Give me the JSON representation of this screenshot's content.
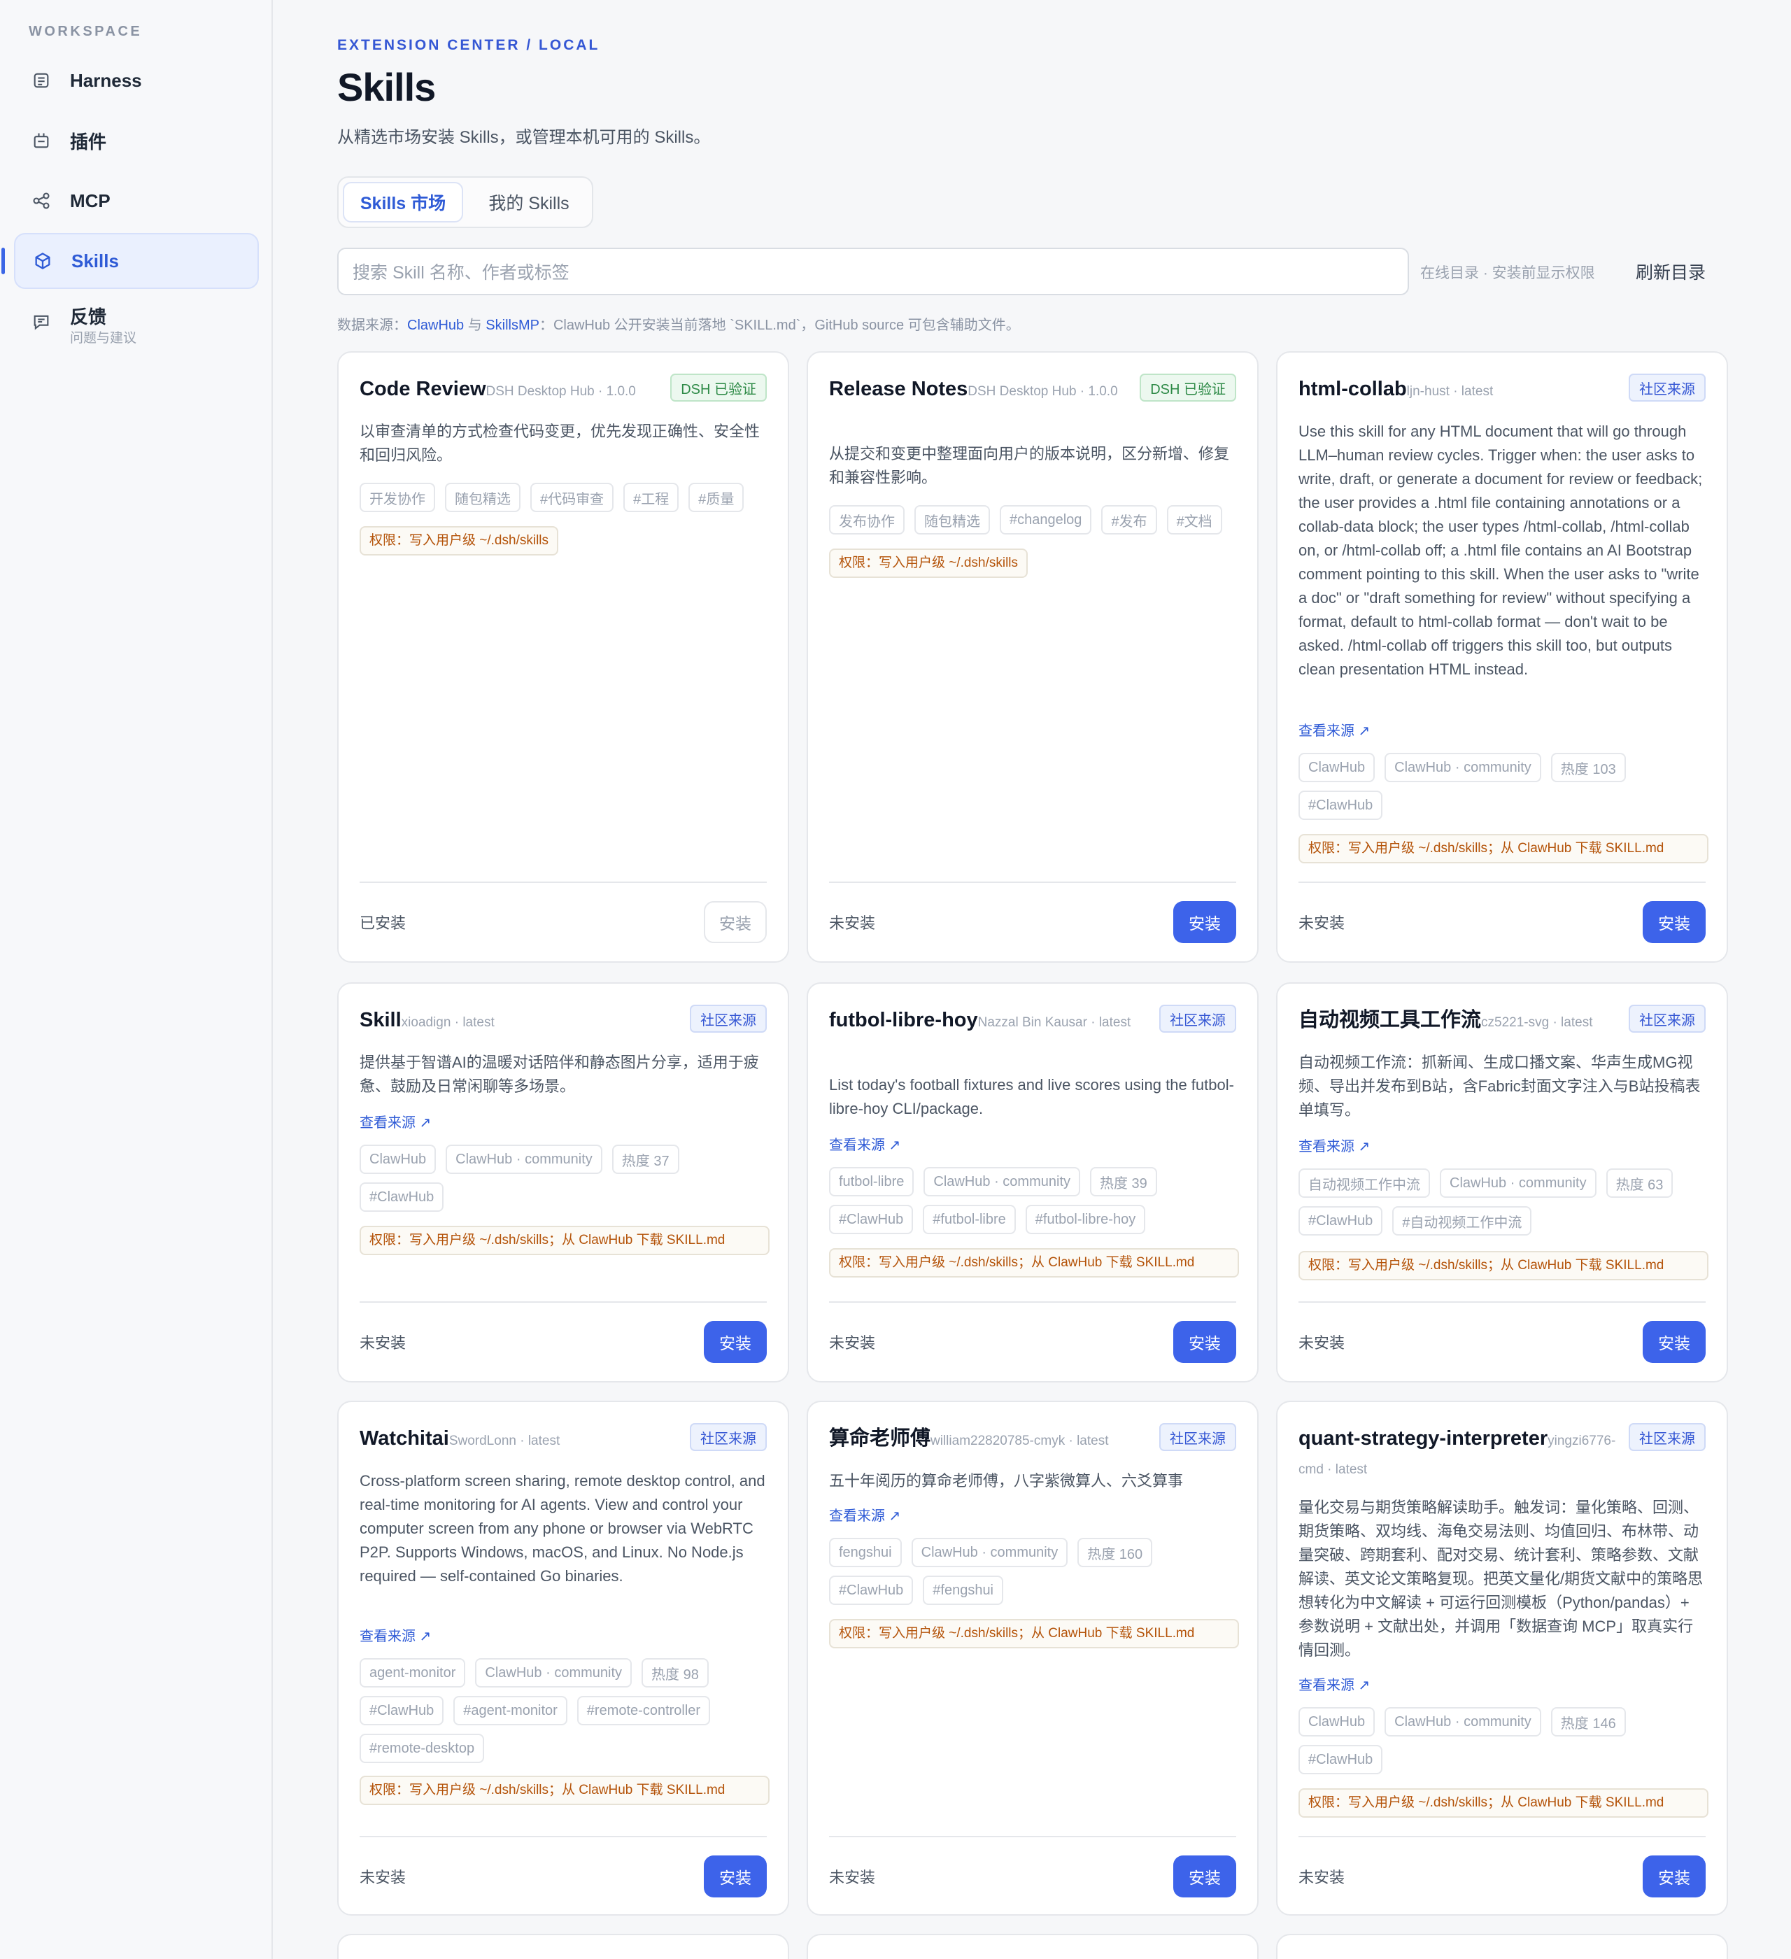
{
  "sidebar": {
    "section": "WORKSPACE",
    "items": [
      {
        "label": "Harness",
        "icon": "harness-icon"
      },
      {
        "label": "插件",
        "icon": "plugin-icon"
      },
      {
        "label": "MCP",
        "icon": "mcp-icon"
      },
      {
        "label": "Skills",
        "icon": "cube-icon"
      },
      {
        "label": "反馈",
        "sublabel": "问题与建议",
        "icon": "feedback-icon"
      }
    ]
  },
  "header": {
    "breadcrumb": "EXTENSION CENTER / LOCAL",
    "title": "Skills",
    "subtitle": "从精选市场安装 Skills，或管理本机可用的 Skills。"
  },
  "tabs": [
    "Skills 市场",
    "我的 Skills"
  ],
  "search": {
    "placeholder": "搜索 Skill 名称、作者或标签",
    "hint": "在线目录 · 安装前显示权限",
    "refresh": "刷新目录"
  },
  "source_note": {
    "prefix": "数据来源：",
    "a": "ClawHub",
    "mid": " 与 ",
    "b": "SkillsMP",
    "suffix": "：ClawHub 公开安装当前落地 `SKILL.md`，GitHub source 可包含辅助文件。"
  },
  "cards": [
    {
      "name": "Code Review",
      "meta": "DSH Desktop Hub · 1.0.0",
      "badge": "DSH 已验证",
      "desc": "以审查清单的方式检查代码变更，优先发现正确性、安全性和回归风险。",
      "tags": [
        "开发协作",
        "随包精选",
        "#代码审查",
        "#工程",
        "#质量"
      ],
      "perm": "权限：写入用户级 ~/.dsh/skills",
      "status": "已安装",
      "button": "安装"
    },
    {
      "name": "Release Notes",
      "meta": "DSH Desktop Hub · 1.0.0",
      "badge": "DSH 已验证",
      "desc": "从提交和变更中整理面向用户的版本说明，区分新增、修复和兼容性影响。",
      "tags": [
        "发布协作",
        "随包精选",
        "#changelog",
        "#发布",
        "#文档"
      ],
      "perm": "权限：写入用户级 ~/.dsh/skills",
      "status": "未安装",
      "button": "安装"
    },
    {
      "name": "html-collab",
      "meta": "ljn-hust · latest",
      "badge": "社区来源",
      "desc": "Use this skill for any HTML document that will go through LLM–human review cycles. Trigger when: the user asks to write, draft, or generate a document for review or feedback; the user provides a .html file containing annotations or a collab-data block; the user types /html-collab, /html-collab on, or /html-collab off; a .html file contains an AI Bootstrap comment pointing to this skill. When the user asks to \"write a doc\" or \"draft something for review\" without specifying a format, default to html-collab format — don't wait to be asked. /html-collab off triggers this skill too, but outputs clean presentation HTML instead.",
      "link": "查看来源 ↗",
      "tags": [
        "ClawHub",
        "ClawHub · community",
        "热度 103",
        "#ClawHub"
      ],
      "perm": "权限：写入用户级 ~/.dsh/skills；从 ClawHub 下载 SKILL.md",
      "status": "未安装",
      "button": "安装"
    },
    {
      "name": "Skill",
      "meta": "xioadign · latest",
      "badge": "社区来源",
      "desc": "提供基于智谱AI的温暖对话陪伴和静态图片分享，适用于疲惫、鼓励及日常闲聊等多场景。",
      "link": "查看来源 ↗",
      "tags": [
        "ClawHub",
        "ClawHub · community",
        "热度 37",
        "#ClawHub"
      ],
      "perm": "权限：写入用户级 ~/.dsh/skills；从 ClawHub 下载 SKILL.md",
      "status": "未安装",
      "button": "安装"
    },
    {
      "name": "futbol-libre-hoy",
      "meta": "Nazzal Bin Kausar · latest",
      "badge": "社区来源",
      "desc": "List today's football fixtures and live scores using the futbol-libre-hoy CLI/package.",
      "link": "查看来源 ↗",
      "tags": [
        "futbol-libre",
        "ClawHub · community",
        "热度 39",
        "#ClawHub",
        "#futbol-libre",
        "#futbol-libre-hoy"
      ],
      "perm": "权限：写入用户级 ~/.dsh/skills；从 ClawHub 下载 SKILL.md",
      "status": "未安装",
      "button": "安装"
    },
    {
      "name": "自动视频工具工作流",
      "meta": "cz5221-svg · latest",
      "badge": "社区来源",
      "desc": "自动视频工作流：抓新闻、生成口播文案、华声生成MG视频、导出并发布到B站，含Fabric封面文字注入与B站投稿表单填写。",
      "link": "查看来源 ↗",
      "tags": [
        "自动视频工作中流",
        "ClawHub · community",
        "热度 63",
        "#ClawHub",
        "#自动视频工作中流"
      ],
      "perm": "权限：写入用户级 ~/.dsh/skills；从 ClawHub 下载 SKILL.md",
      "status": "未安装",
      "button": "安装"
    },
    {
      "name": "Watchitai",
      "meta": "SwordLonn · latest",
      "badge": "社区来源",
      "desc": "Cross-platform screen sharing, remote desktop control, and real-time monitoring for AI agents. View and control your computer screen from any phone or browser via WebRTC P2P. Supports Windows, macOS, and Linux. No Node.js required — self-contained Go binaries.",
      "link": "查看来源 ↗",
      "tags": [
        "agent-monitor",
        "ClawHub · community",
        "热度 98",
        "#ClawHub",
        "#agent-monitor",
        "#remote-controller",
        "#remote-desktop"
      ],
      "perm": "权限：写入用户级 ~/.dsh/skills；从 ClawHub 下载 SKILL.md",
      "status": "未安装",
      "button": "安装"
    },
    {
      "name": "算命老师傅",
      "meta": "william22820785-cmyk · latest",
      "badge": "社区来源",
      "desc": "五十年阅历的算命老师傅，八字紫微算人、六爻算事",
      "link": "查看来源 ↗",
      "tags": [
        "fengshui",
        "ClawHub · community",
        "热度 160",
        "#ClawHub",
        "#fengshui"
      ],
      "perm": "权限：写入用户级 ~/.dsh/skills；从 ClawHub 下载 SKILL.md",
      "status": "未安装",
      "button": "安装"
    },
    {
      "name": "quant-strategy-interpreter",
      "meta": "yingzi6776-cmd · latest",
      "badge": "社区来源",
      "desc": "量化交易与期货策略解读助手。触发词：量化策略、回测、期货策略、双均线、海龟交易法则、均值回归、布林带、动量突破、跨期套利、配对交易、统计套利、策略参数、文献解读、英文论文策略复现。把英文量化/期货文献中的策略思想转化为中文解读 + 可运行回测模板（Python/pandas）+ 参数说明 + 文献出处，并调用「数据查询 MCP」取真实行情回测。",
      "link": "查看来源 ↗",
      "tags": [
        "ClawHub",
        "ClawHub · community",
        "热度 146",
        "#ClawHub"
      ],
      "perm": "权限：写入用户级 ~/.dsh/skills；从 ClawHub 下载 SKILL.md",
      "status": "未安装",
      "button": "安装"
    }
  ],
  "colors": {
    "accent": "#3d63ea",
    "link": "#2f5bd6",
    "verified": "#2e8a47",
    "permission": "#b45309"
  }
}
